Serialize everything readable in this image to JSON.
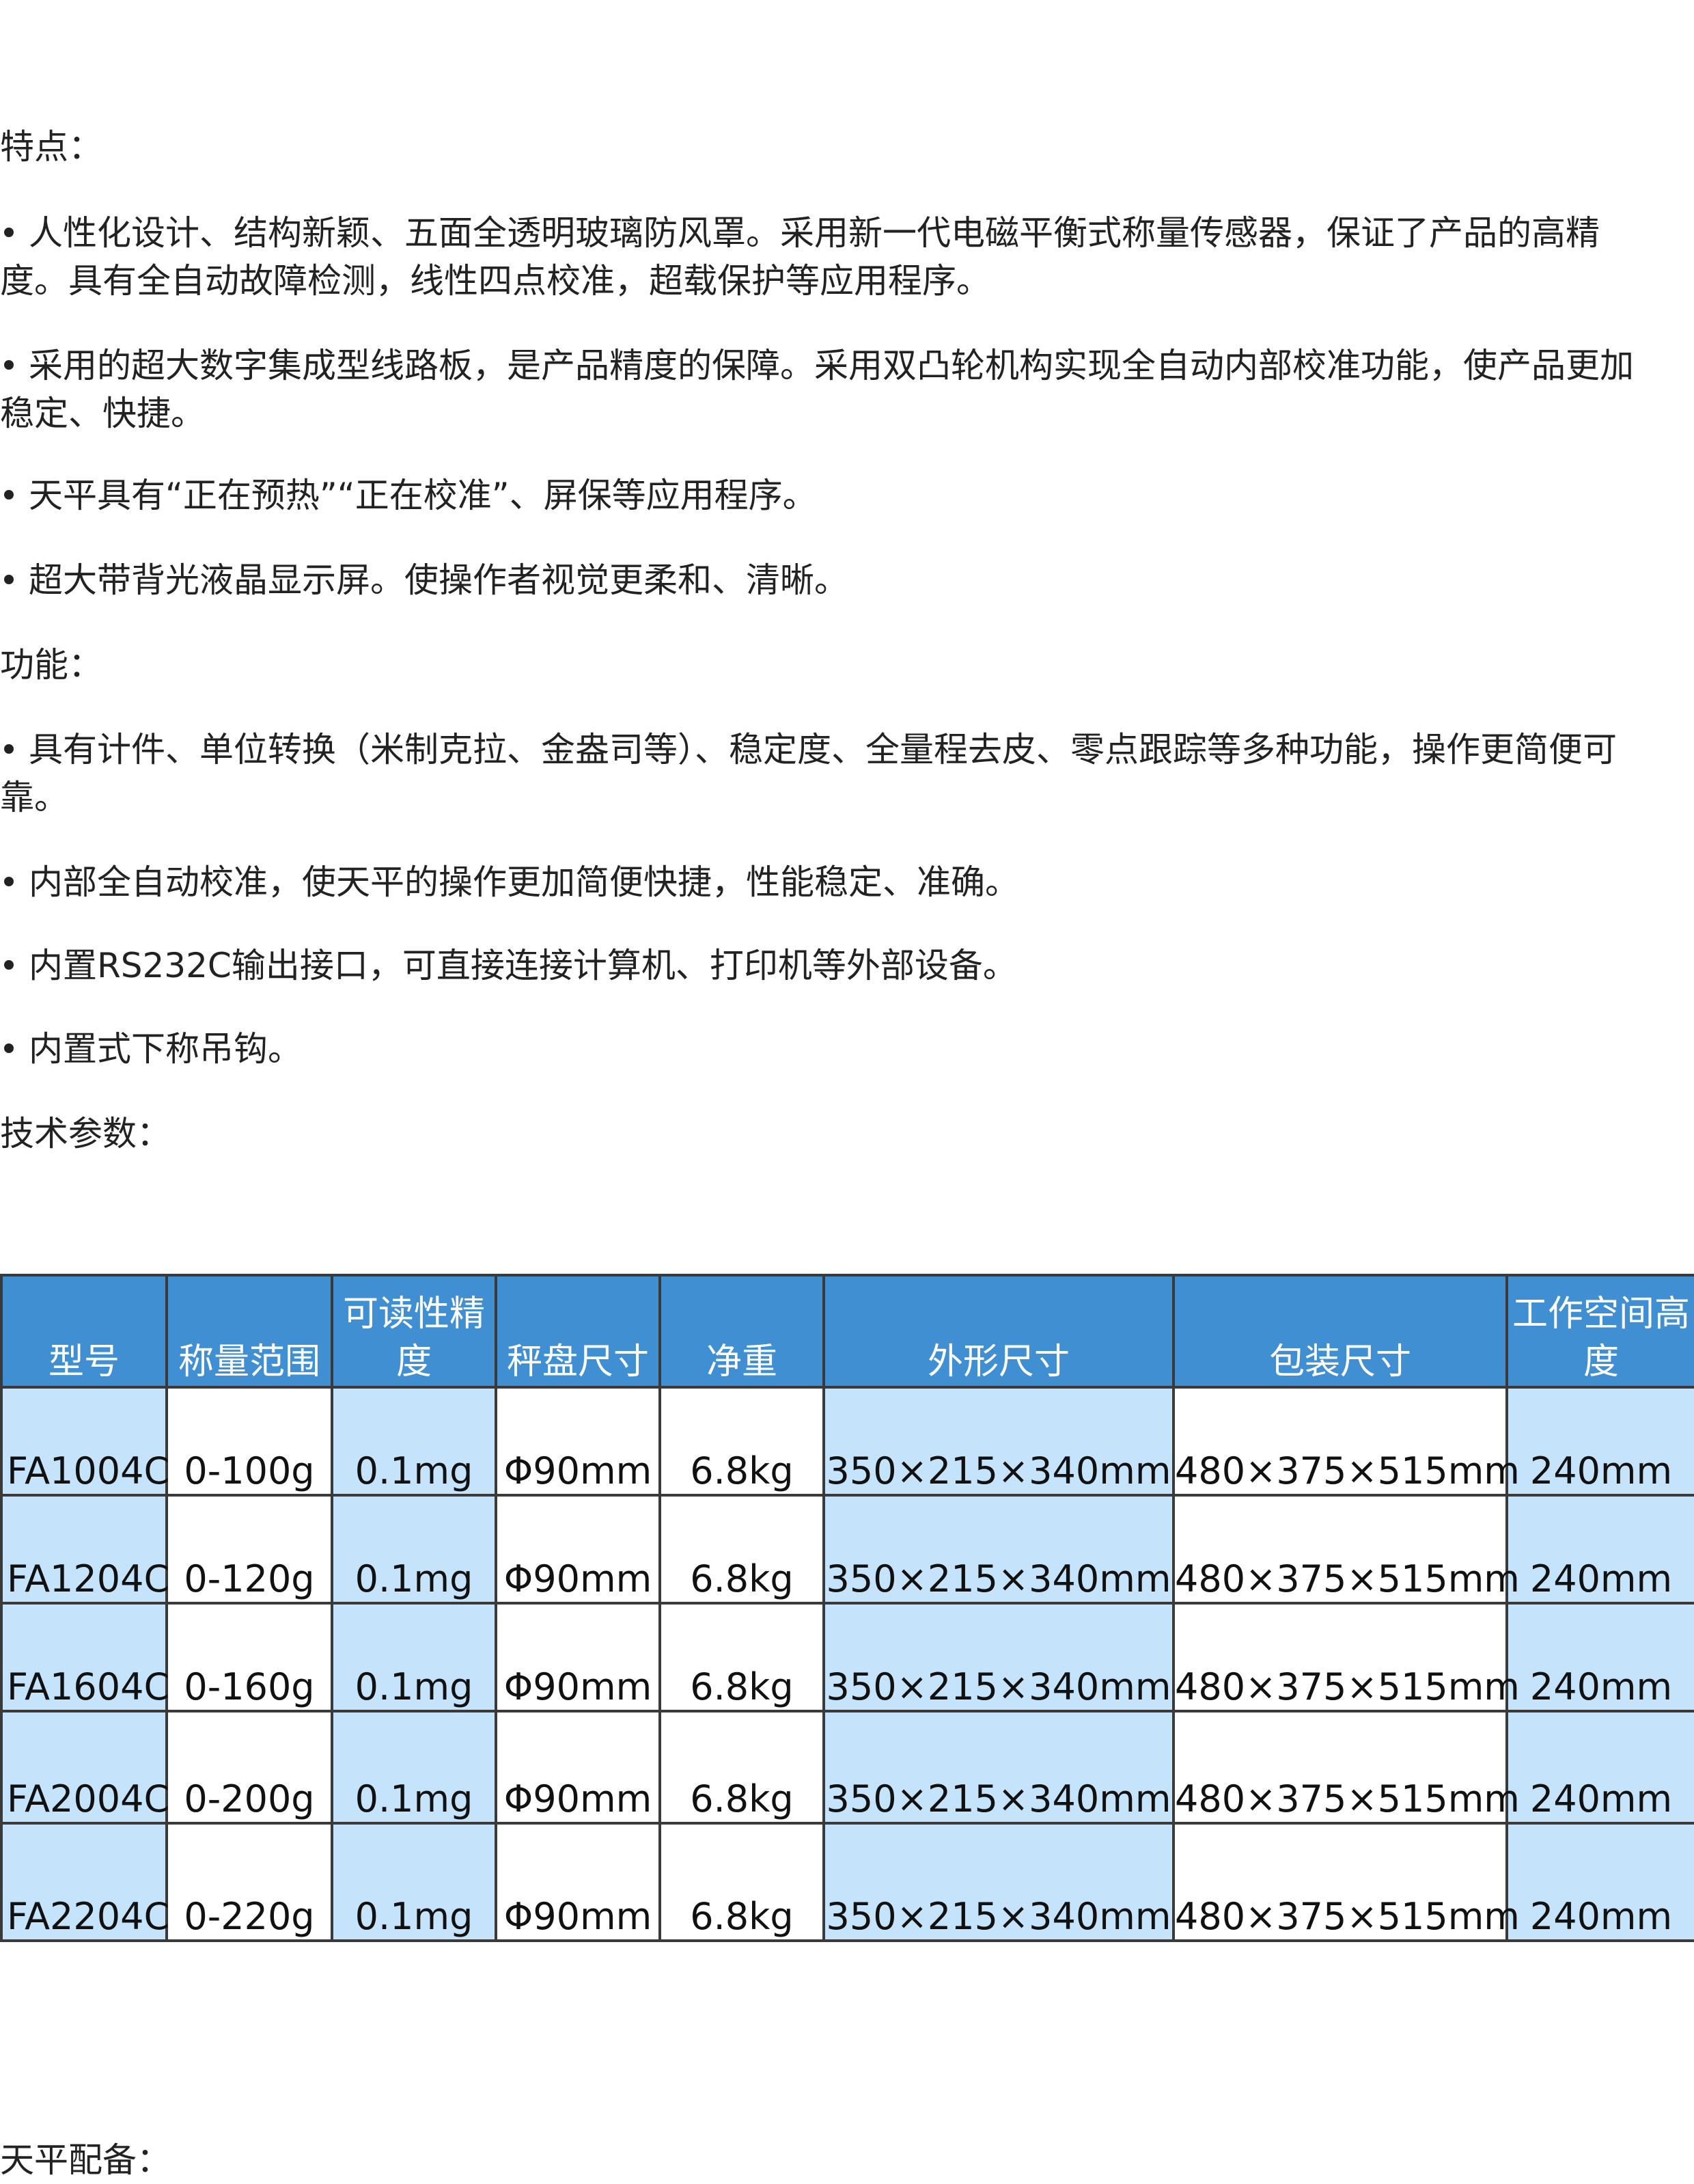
{
  "features_heading": "特点：",
  "features": [
    "人性化设计、结构新颖、五面全透明玻璃防风罩。采用新一代电磁平衡式称量传感器，保证了产品的高精度。具有全自动故障检测，线性四点校准，超载保护等应用程序。",
    "采用的超大数字集成型线路板，是产品精度的保障。采用双凸轮机构实现全自动内部校准功能，使产品更加稳定、快捷。",
    "天平具有“正在预热”“正在校准”、屏保等应用程序。",
    "超大带背光液晶显示屏。使操作者视觉更柔和、清晰。"
  ],
  "functions_heading": "功能：",
  "functions": [
    "具有计件、单位转换（米制克拉、金盎司等）、稳定度、全量程去皮、零点跟踪等多种功能，操作更简便可靠。",
    "内部全自动校准，使天平的操作更加简便快捷，性能稳定、准确。",
    "内置RS232C输出接口，可直接连接计算机、打印机等外部设备。",
    "内置式下称吊钩。"
  ],
  "specs_heading": "技术参数：",
  "table": {
    "headers": [
      "型号",
      "称量范围",
      "可读性精度",
      "秤盘尺寸",
      "净重",
      "外形尺寸",
      "包装尺寸",
      "工作空间高度"
    ],
    "rows": [
      [
        "FA1004C",
        "0-100g",
        "0.1mg",
        "Φ90mm",
        "6.8kg",
        "350×215×340mm",
        "480×375×515mm",
        "240mm"
      ],
      [
        "FA1204C",
        "0-120g",
        "0.1mg",
        "Φ90mm",
        "6.8kg",
        "350×215×340mm",
        "480×375×515mm",
        "240mm"
      ],
      [
        "FA1604C",
        "0-160g",
        "0.1mg",
        "Φ90mm",
        "6.8kg",
        "350×215×340mm",
        "480×375×515mm",
        "240mm"
      ],
      [
        "FA2004C",
        "0-200g",
        "0.1mg",
        "Φ90mm",
        "6.8kg",
        "350×215×340mm",
        "480×375×515mm",
        "240mm"
      ],
      [
        "FA2204C",
        "0-220g",
        "0.1mg",
        "Φ90mm",
        "6.8kg",
        "350×215×340mm",
        "480×375×515mm",
        "240mm"
      ]
    ]
  },
  "accessories_heading": "天平配备：",
  "colors": {
    "header_bg": "#3f8fd2",
    "alt_cell_bg": "#c5e3fb",
    "border": "#3a3a3a"
  }
}
